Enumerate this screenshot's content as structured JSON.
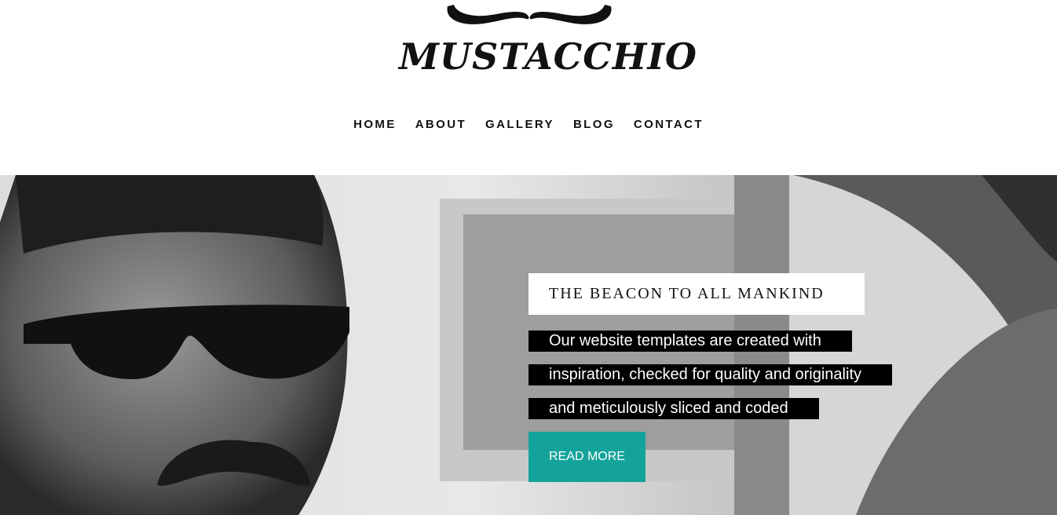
{
  "brand": {
    "logo_text": "MUSTACCHIO",
    "logo_icon": "mustache-icon"
  },
  "nav": {
    "items": [
      {
        "label": "HOME"
      },
      {
        "label": "ABOUT"
      },
      {
        "label": "GALLERY"
      },
      {
        "label": "BLOG"
      },
      {
        "label": "CONTACT"
      }
    ]
  },
  "hero": {
    "title": "THE BEACON TO ALL MANKIND",
    "lines": [
      "Our website templates are created with",
      "inspiration, checked for quality and originality",
      "and meticulously sliced and coded"
    ],
    "cta_label": "READ MORE",
    "cta_color": "#14a39a"
  }
}
